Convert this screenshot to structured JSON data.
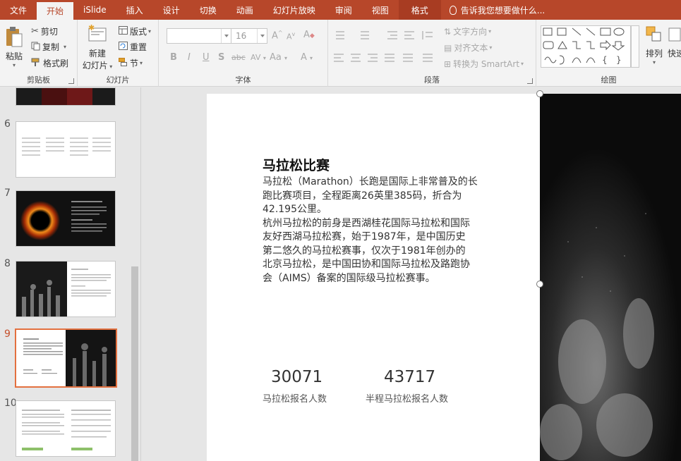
{
  "menu": {
    "tabs": [
      "文件",
      "开始",
      "iSlide",
      "插入",
      "设计",
      "切换",
      "动画",
      "幻灯片放映",
      "审阅",
      "视图",
      "格式"
    ],
    "tell_me": "告诉我您想要做什么..."
  },
  "ribbon": {
    "clipboard": {
      "label": "剪贴板",
      "paste": "粘贴",
      "cut": "剪切",
      "copy": "复制",
      "format_painter": "格式刷"
    },
    "slides": {
      "label": "幻灯片",
      "new_slide": "新建",
      "new_slide2": "幻灯片",
      "layout": "版式",
      "reset": "重置",
      "section": "节"
    },
    "font": {
      "label": "字体",
      "font_size": "16",
      "bold": "B",
      "italic": "I",
      "underline": "U",
      "shadow": "S",
      "strike": "abc",
      "spacing": "AV",
      "case": "Aa",
      "color": "A",
      "grow": "A",
      "shrink": "A",
      "clear": "A"
    },
    "paragraph": {
      "label": "段落",
      "text_direction": "文字方向",
      "align_text": "对齐文本",
      "smartart": "转换为 SmartArt"
    },
    "drawing": {
      "label": "绘图",
      "arrange": "排列",
      "quick": "快速"
    }
  },
  "thumbnails": [
    {
      "num": "6"
    },
    {
      "num": "7"
    },
    {
      "num": "8"
    },
    {
      "num": "9"
    },
    {
      "num": "10"
    }
  ],
  "slide": {
    "title": "马拉松比赛",
    "body_lines": [
      "马拉松（Marathon）长跑是国际上非常普及的长",
      "跑比赛项目，全程距离26英里385码，折合为",
      "42.195公里。",
      "杭州马拉松的前身是西湖桂花国际马拉松和国际",
      "友好西湖马拉松赛，始于1987年，是中国历史",
      "第二悠久的马拉松赛事，仅次于1981年创办的",
      "北京马拉松，是中国田协和国际马拉松及路跑协",
      "会（AIMS）备案的国际级马拉松赛事。"
    ],
    "stats": [
      {
        "value": "30071",
        "label": "马拉松报名人数"
      },
      {
        "value": "43717",
        "label": "半程马拉松报名人数"
      }
    ]
  },
  "colors": {
    "accent": "#b7472a",
    "active_thumb": "#e3703f"
  }
}
